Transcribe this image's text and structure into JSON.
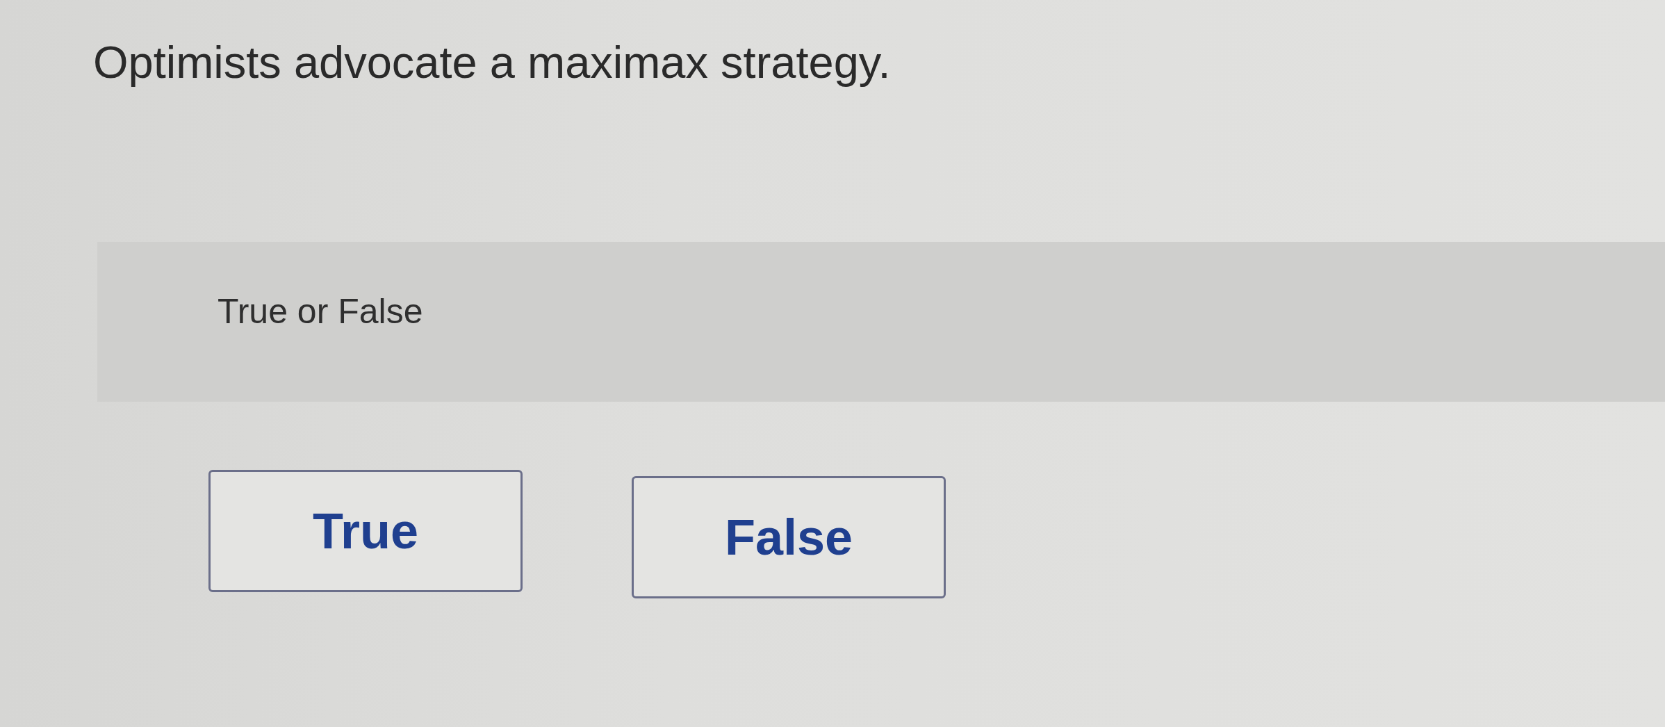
{
  "question": "Optimists advocate a maximax strategy.",
  "prompt": "True or False",
  "options": [
    {
      "label": "True",
      "selected": false
    },
    {
      "label": "False",
      "selected": false
    }
  ]
}
